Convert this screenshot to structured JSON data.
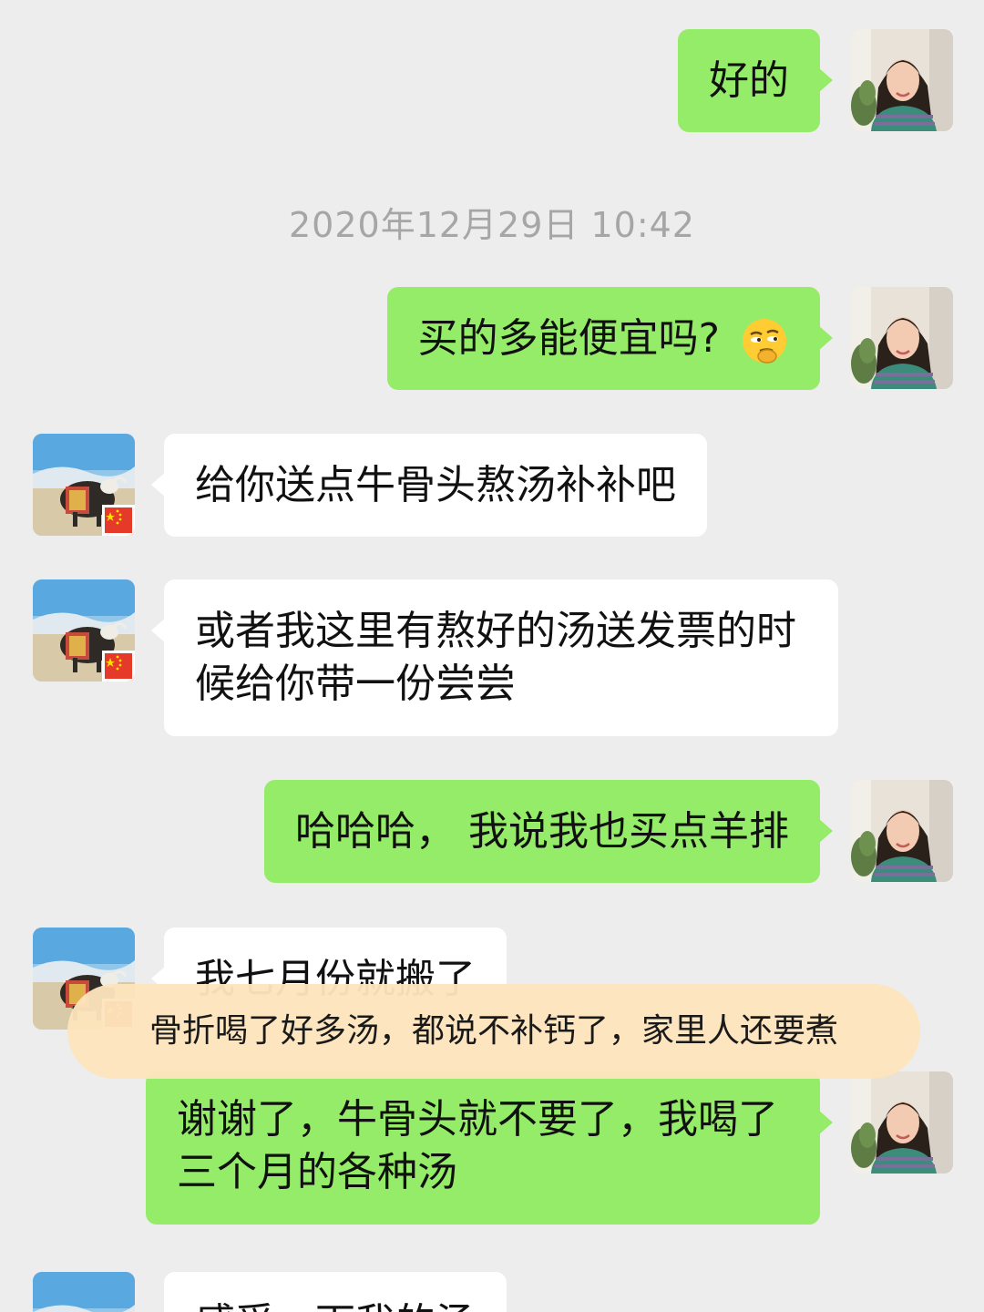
{
  "timestamp": "2020年12月29日 10:42",
  "messages": [
    {
      "sender": "me",
      "text": "好的"
    },
    {
      "sender": "me",
      "text": "买的多能便宜吗?",
      "emoji": "smirk-emoji"
    },
    {
      "sender": "them",
      "text": "给你送点牛骨头熬汤补补吧"
    },
    {
      "sender": "them",
      "text": "或者我这里有熬好的汤送发票的时候给你带一份尝尝"
    },
    {
      "sender": "me",
      "text": "哈哈哈， 我说我也买点羊排"
    },
    {
      "sender": "them",
      "text": "我七月份就搬了"
    },
    {
      "sender": "me",
      "text": "谢谢了，牛骨头就不要了，我喝了三个月的各种汤"
    },
    {
      "sender": "them",
      "text": "感受一下我的汤"
    }
  ],
  "caption": "骨折喝了好多汤，都说不补钙了，家里人还要煮",
  "avatars": {
    "me": "woman-portrait-avatar",
    "them": "yak-landscape-avatar-with-china-flag"
  },
  "colors": {
    "background": "#ededed",
    "my_bubble": "#95ec69",
    "their_bubble": "#ffffff",
    "caption_bg": "#fce4bc"
  }
}
